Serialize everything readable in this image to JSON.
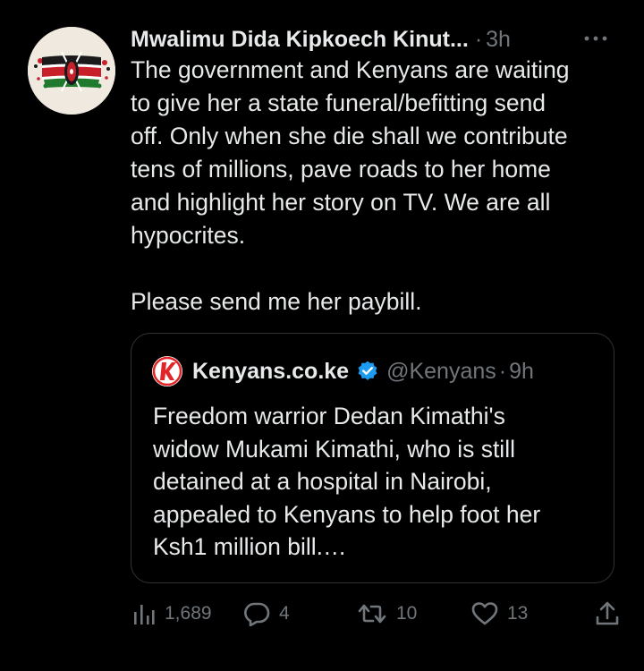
{
  "tweet": {
    "author_name": "Mwalimu Dida Kipkoech Kinut...",
    "separator": "·",
    "time": "3h",
    "text": "The government and Kenyans are waiting\nto give her a state funeral/befitting send\noff. Only when she die shall we contribute\ntens of millions, pave roads to her home\nand highlight her story on TV. We are all\nhypocrites.\n\nPlease send me her paybill.",
    "avatar_icon": "kenya-flag-avatar",
    "more_icon": "more-horizontal-icon"
  },
  "quote": {
    "avatar_icon": "kenyans-logo-icon",
    "name": "Kenyans.co.ke",
    "verified_icon": "verified-badge-icon",
    "handle": "@Kenyans",
    "separator": "·",
    "time": "9h",
    "text": "Freedom warrior Dedan Kimathi's\nwidow Mukami Kimathi, who is still\ndetained at a hospital in Nairobi,\nappealed to Kenyans to help foot her\nKsh1 million bill.…"
  },
  "actions": {
    "views": {
      "icon": "views-chart-icon",
      "count": "1,689"
    },
    "reply": {
      "icon": "reply-bubble-icon",
      "count": "4"
    },
    "retweet": {
      "icon": "retweet-icon",
      "count": "10"
    },
    "like": {
      "icon": "heart-icon",
      "count": "13"
    },
    "share": {
      "icon": "share-upload-icon"
    }
  },
  "colors": {
    "background": "#000000",
    "text": "#e7e9ea",
    "secondary": "#71767b",
    "border": "#2f3336",
    "verified": "#1d9bf0",
    "kenyans_red": "#e32428"
  }
}
